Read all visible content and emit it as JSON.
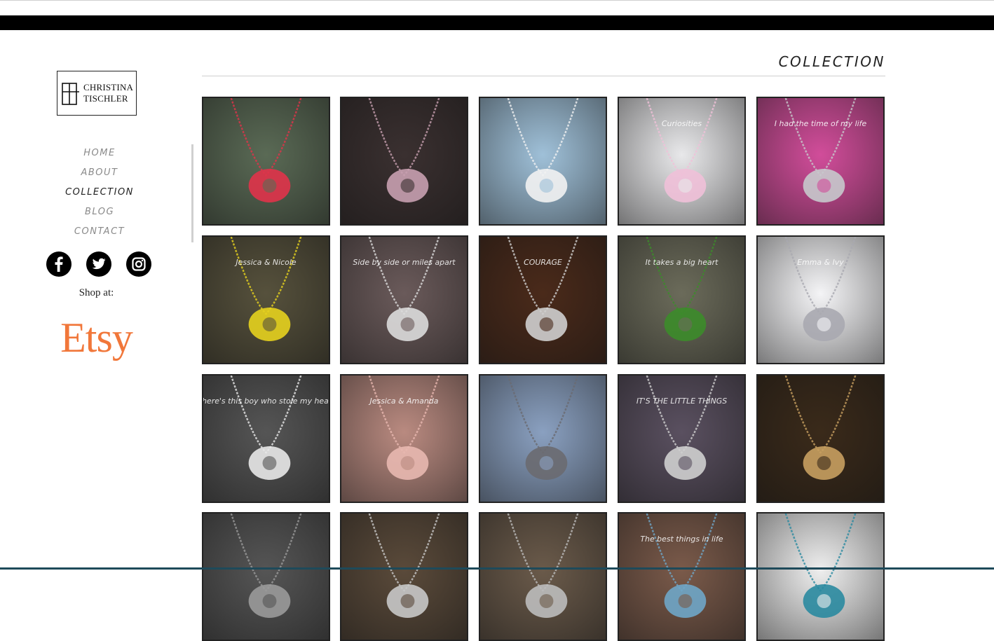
{
  "brand": {
    "line1": "CHRISTINA",
    "line2": "TISCHLER"
  },
  "nav": {
    "items": [
      {
        "label": "HOME",
        "active": false
      },
      {
        "label": "ABOUT",
        "active": false
      },
      {
        "label": "COLLECTION",
        "active": true
      },
      {
        "label": "BLOG",
        "active": false
      },
      {
        "label": "CONTACT",
        "active": false
      }
    ]
  },
  "social": {
    "icons": [
      "facebook-icon",
      "twitter-icon",
      "instagram-icon"
    ]
  },
  "shop": {
    "label": "Shop at:",
    "etsy": "Etsy",
    "etsy_color": "#f1773a"
  },
  "page": {
    "title": "COLLECTION"
  },
  "gallery": {
    "photos": [
      {
        "subject": "charm-bracelet-flowers",
        "bg": "#5a6a55",
        "accent": "#e0334a",
        "text": ""
      },
      {
        "subject": "pink-mug-books",
        "bg": "#3a3030",
        "accent": "#c8a0b0",
        "text": ""
      },
      {
        "subject": "craft-tent",
        "bg": "#9fc0d8",
        "accent": "#f2f2f2",
        "text": ""
      },
      {
        "subject": "curiosities-shop",
        "bg": "#e8e8ea",
        "accent": "#f0c0d8",
        "text": "Curiosities"
      },
      {
        "subject": "cuff-on-coneflower",
        "bg": "#d14d9a",
        "accent": "#c7c9cc",
        "text": "I had the time of my life"
      },
      {
        "subject": "yellow-flowers-pendant",
        "bg": "#56513c",
        "accent": "#e6d21e",
        "text": "Jessica & Nicole"
      },
      {
        "subject": "two-pendants-rock",
        "bg": "#6a5a5a",
        "accent": "#dcdcdc",
        "text": "Side by side or miles apart"
      },
      {
        "subject": "courage-bar",
        "bg": "#4a2a1a",
        "accent": "#cfcfcf",
        "text": "COURAGE"
      },
      {
        "subject": "ivy-teacher-pendant",
        "bg": "#6b6b5a",
        "accent": "#3c8c2a",
        "text": "It takes a big heart"
      },
      {
        "subject": "washer-necklace-white",
        "bg": "#f4f4f6",
        "accent": "#a9a9b0",
        "text": "Emma & Ivy"
      },
      {
        "subject": "newspaper-dog-tag",
        "bg": "#555555",
        "accent": "#e8e8e8",
        "text": "There's this boy who stole my heart"
      },
      {
        "subject": "iris-washer",
        "bg": "#b98a80",
        "accent": "#e8b8b0",
        "text": "Jessica & Amanda"
      },
      {
        "subject": "stone-cairn",
        "bg": "#8aa0c0",
        "accent": "#6a6a70",
        "text": ""
      },
      {
        "subject": "little-things",
        "bg": "#5a5060",
        "accent": "#cfcfcf",
        "text": "IT'S THE LITTLE THINGS"
      },
      {
        "subject": "cuffs-display",
        "bg": "#3a2a1a",
        "accent": "#c8a060",
        "text": ""
      },
      {
        "subject": "tools-bw",
        "bg": "#555555",
        "accent": "#9a9a9a",
        "text": ""
      },
      {
        "subject": "bark-necklace",
        "bg": "#5a4a3a",
        "accent": "#c8c8c8",
        "text": ""
      },
      {
        "subject": "bark-tree-pendant",
        "bg": "#6a5a4a",
        "accent": "#bcbcbc",
        "text": ""
      },
      {
        "subject": "blue-pendant-pearl",
        "bg": "#7a5a4a",
        "accent": "#6fa6c8",
        "text": "The best things in life"
      },
      {
        "subject": "three-necklaces",
        "bg": "#eeeeee",
        "accent": "#2a8aa0",
        "text": ""
      }
    ]
  }
}
